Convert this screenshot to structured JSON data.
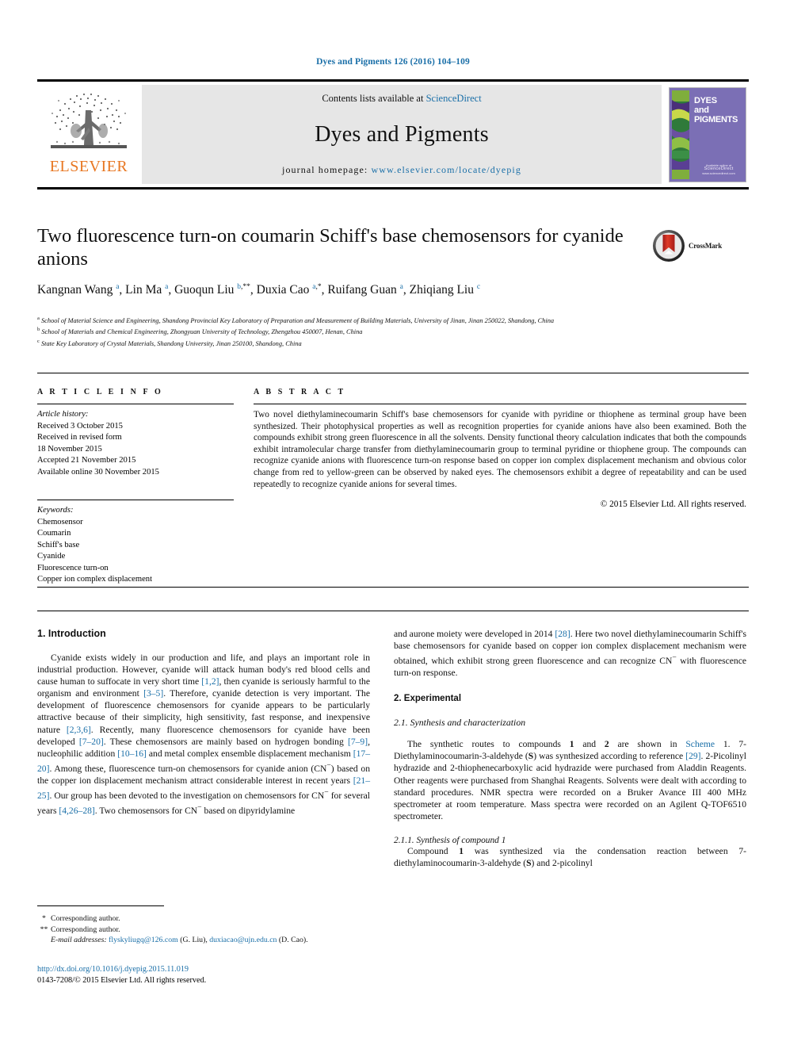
{
  "running_head": "Dyes and Pigments 126 (2016) 104–109",
  "masthead": {
    "publisher": "ELSEVIER",
    "contents_prefix": "Contents lists available at ",
    "contents_link": "ScienceDirect",
    "journal_name": "Dyes and Pigments",
    "homepage_prefix": "journal homepage: ",
    "homepage_url": "www.elsevier.com/locate/dyepig",
    "cover": {
      "title_line1": "DYES",
      "title_line2": "and",
      "title_line3": "PIGMENTS",
      "foot_line1": "Available online at",
      "foot_line2": "ScienceDirect",
      "foot_line3": "www.sciencedirect.com"
    }
  },
  "article": {
    "title": "Two fluorescence turn-on coumarin Schiff's base chemosensors for cyanide anions",
    "crossmark_label": "CrossMark",
    "authors_html": "Kangnan Wang <sup>a</sup>, Lin Ma <sup>a</sup>, Guoqun Liu <sup>b</sup><sup class=\"star\">,**</sup>, Duxia Cao <sup>a</sup><sup class=\"star\">,*</sup>, Ruifang Guan <sup>a</sup>, Zhiqiang Liu <sup>c</sup>",
    "affiliations": [
      "a School of Material Science and Engineering, Shandong Provincial Key Laboratory of Preparation and Measurement of Building Materials, University of Jinan, Jinan 250022, Shandong, China",
      "b School of Materials and Chemical Engineering, Zhongyuan University of Technology, Zhengzhou 450007, Henan, China",
      "c State Key Laboratory of Crystal Materials, Shandong University, Jinan 250100, Shandong, China"
    ]
  },
  "article_info": {
    "heading": "A R T I C L E    I N F O",
    "history_label": "Article history:",
    "history": [
      "Received 3 October 2015",
      "Received in revised form",
      "18 November 2015",
      "Accepted 21 November 2015",
      "Available online 30 November 2015"
    ],
    "keywords_label": "Keywords:",
    "keywords": [
      "Chemosensor",
      "Coumarin",
      "Schiff's base",
      "Cyanide",
      "Fluorescence turn-on",
      "Copper ion complex displacement"
    ]
  },
  "abstract": {
    "heading": "A B S T R A C T",
    "text": "Two novel diethylaminecoumarin Schiff's base chemosensors for cyanide with pyridine or thiophene as terminal group have been synthesized. Their photophysical properties as well as recognition properties for cyanide anions have also been examined. Both the compounds exhibit strong green fluorescence in all the solvents. Density functional theory calculation indicates that both the compounds exhibit intramolecular charge transfer from diethylaminecoumarin group to terminal pyridine or thiophene group. The compounds can recognize cyanide anions with fluorescence turn-on response based on copper ion complex displacement mechanism and obvious color change from red to yellow-green can be observed by naked eyes. The chemosensors exhibit a degree of repeatability and can be used repeatedly to recognize cyanide anions for several times.",
    "copyright": "© 2015 Elsevier Ltd. All rights reserved."
  },
  "body": {
    "intro_heading": "1. Introduction",
    "intro_p1_html": "Cyanide exists widely in our production and life, and plays an important role in industrial production. However, cyanide will attack human body's red blood cells and cause human to suffocate in very short time <span class=\"ref\">[1,2]</span>, then cyanide is seriously harmful to the organism and environment <span class=\"ref\">[3–5]</span>. Therefore, cyanide detection is very important. The development of fluorescence chemosensors for cyanide appears to be particularly attractive because of their simplicity, high sensitivity, fast response, and inexpensive nature <span class=\"ref\">[2,3,6]</span>. Recently, many fluorescence chemosensors for cyanide have been developed <span class=\"ref\">[7–20]</span>. These chemosensors are mainly based on hydrogen bonding <span class=\"ref\">[7–9]</span>, nucleophilic addition <span class=\"ref\">[10–16]</span> and metal complex ensemble displacement mechanism <span class=\"ref\">[17–20]</span>. Among these, fluorescence turn-on chemosensors for cyanide anion (CN<sup>−</sup>) based on the copper ion displacement mechanism attract considerable interest in recent years <span class=\"ref\">[21–25]</span>. Our group has been devoted to the investigation on chemosensors for CN<sup>−</sup> for several years <span class=\"ref\">[4,26–28]</span>. Two chemosensors for CN<sup>−</sup> based on dipyridylamine",
    "intro_p1_cont_html": "and aurone moiety were developed in 2014 <span class=\"ref\">[28]</span>. Here two novel diethylaminecoumarin Schiff's base chemosensors for cyanide based on copper ion complex displacement mechanism were obtained, which exhibit strong green fluorescence and can recognize CN<sup>−</sup> with fluorescence turn-on response.",
    "experimental_heading": "2. Experimental",
    "synthesis_heading": "2.1. Synthesis and characterization",
    "synthesis_p_html": "The synthetic routes to compounds <span class=\"bold\">1</span> and <span class=\"bold\">2</span> are shown in <span class=\"ref\">Scheme</span> 1. 7-Diethylaminocoumarin-3-aldehyde (<span class=\"bold\">S</span>) was synthesized according to reference <span class=\"ref\">[29]</span>. 2-Picolinyl hydrazide and 2-thiophenecarboxylic acid hydrazide were purchased from Aladdin Reagents. Other reagents were purchased from Shanghai Reagents. Solvents were dealt with according to standard procedures. NMR spectra were recorded on a Bruker Avance III 400 MHz spectrometer at room temperature. Mass spectra were recorded on an Agilent Q-TOF6510 spectrometer.",
    "compound1_heading": "2.1.1. Synthesis of compound 1",
    "compound1_p_html": "Compound <span class=\"bold\">1</span> was synthesized via the condensation reaction between 7-diethylaminocoumarin-3-aldehyde (<span class=\"bold\">S</span>) and 2-picolinyl"
  },
  "footer": {
    "corresponding_1_mark": "*",
    "corresponding_1": "Corresponding author.",
    "corresponding_2_mark": "**",
    "corresponding_2": "Corresponding author.",
    "email_label": "E-mail addresses:",
    "email_1": "flyskyliugq@126.com",
    "email_1_owner": "(G. Liu),",
    "email_2": "duxiacao@ujn.edu.cn",
    "email_2_owner": "(D. Cao).",
    "doi": "http://dx.doi.org/10.1016/j.dyepig.2015.11.019",
    "issn_line": "0143-7208/© 2015 Elsevier Ltd. All rights reserved."
  },
  "colors": {
    "link": "#1a6fa8",
    "elsevier_orange": "#E87722",
    "cover_purple": "#7b6fb5",
    "crossmark_red": "#C1272D"
  }
}
